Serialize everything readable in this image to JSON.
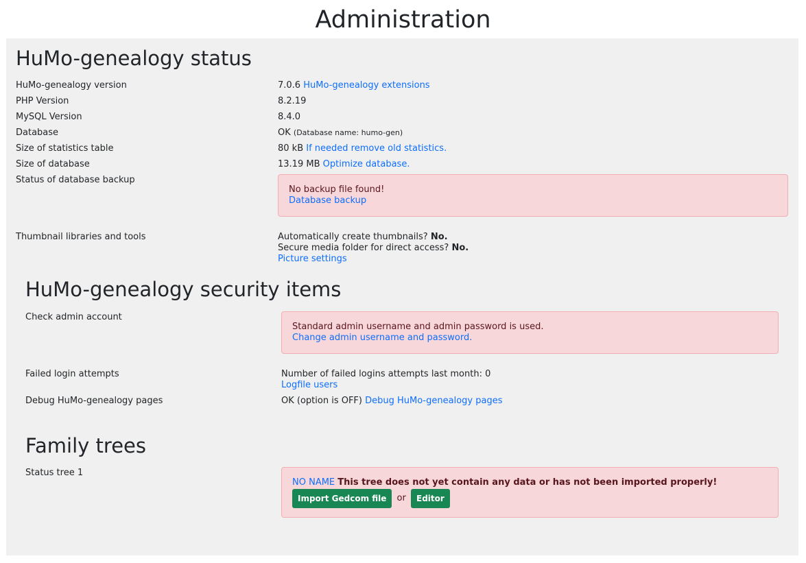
{
  "page": {
    "title": "Administration"
  },
  "status": {
    "heading": "HuMo-genealogy status",
    "version_label": "HuMo-genealogy version",
    "version_value": "7.0.6",
    "extensions_link": "HuMo-genealogy extensions",
    "php_label": "PHP Version",
    "php_value": "8.2.19",
    "mysql_label": "MySQL Version",
    "mysql_value": "8.4.0",
    "database_label": "Database",
    "database_ok": "OK",
    "database_name": "(Database name: humo-gen)",
    "stats_label": "Size of statistics table",
    "stats_value": "80 kB",
    "stats_link": "If needed remove old statistics.",
    "dbsize_label": "Size of database",
    "dbsize_value": "13.19 MB",
    "dbsize_link": "Optimize database.",
    "backup_label": "Status of database backup",
    "backup_message": "No backup file found!",
    "backup_link": "Database backup",
    "thumb_label": "Thumbnail libraries and tools",
    "thumb_auto_text": "Automatically create thumbnails?",
    "thumb_auto_value": "No.",
    "thumb_secure_text": "Secure media folder for direct access?",
    "thumb_secure_value": "No.",
    "thumb_link": "Picture settings"
  },
  "security": {
    "heading": "HuMo-genealogy security items",
    "admin_label": "Check admin account",
    "admin_message": "Standard admin username and admin password is used.",
    "admin_link": "Change admin username and password.",
    "failed_label": "Failed login attempts",
    "failed_text": "Number of failed logins attempts last month: 0",
    "failed_link": "Logfile users",
    "debug_label": "Debug HuMo-genealogy pages",
    "debug_value": "OK (option is OFF)",
    "debug_link": "Debug HuMo-genealogy pages"
  },
  "trees": {
    "heading": "Family trees",
    "tree_label": "Status tree 1",
    "tree_name_link": "NO NAME",
    "tree_warning": "This tree does not yet contain any data or has not been imported properly!",
    "import_button": "Import Gedcom file",
    "or_text": "or",
    "editor_button": "Editor"
  }
}
